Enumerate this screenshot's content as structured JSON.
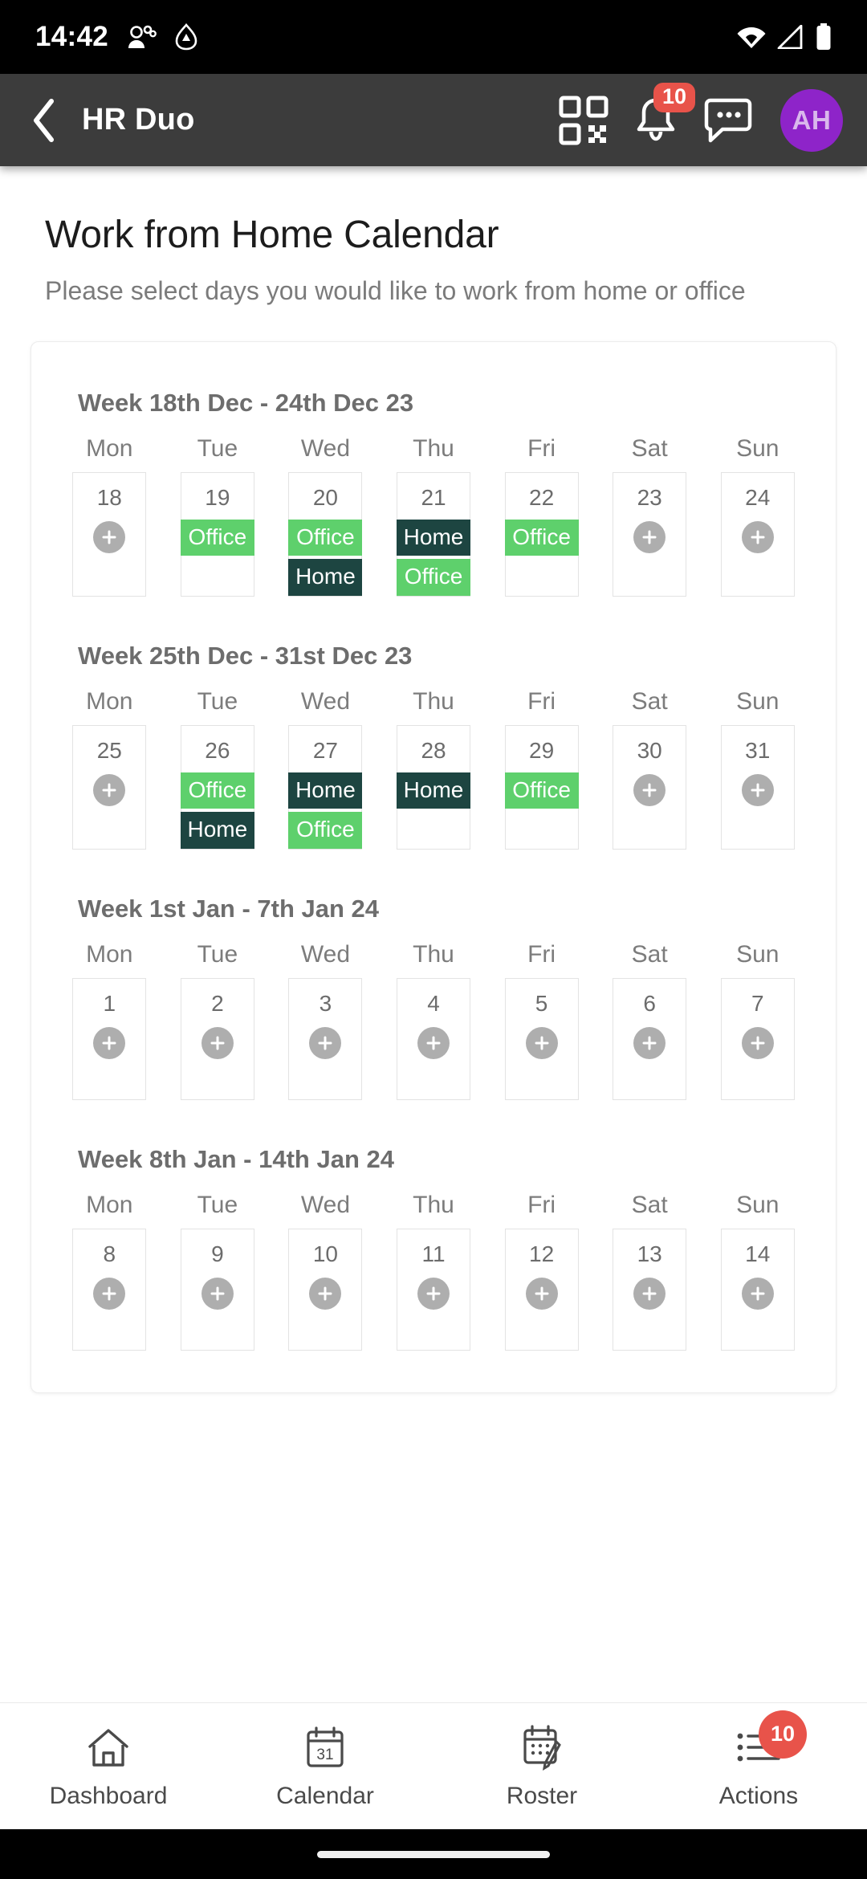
{
  "status_bar": {
    "time": "14:42",
    "icons": [
      "people-icon",
      "drive-triangle-icon",
      "wifi-icon",
      "signal-icon",
      "battery-icon"
    ]
  },
  "app_bar": {
    "back_icon": "chevron-left-icon",
    "title": "HR Duo",
    "qr_icon": "qr-code-icon",
    "bell_icon": "bell-icon",
    "bell_badge": "10",
    "chat_icon": "chat-bubble-icon",
    "avatar_initials": "AH",
    "avatar_color": "#8e24c9",
    "background": "#3c3c3c"
  },
  "page": {
    "title": "Work from Home Calendar",
    "subtitle": "Please select days you would like to work from home or office"
  },
  "legend_colors": {
    "office": "#5ed06c",
    "home": "#1d4541",
    "add_button": "#aeaeae",
    "badge_red": "#e8534a"
  },
  "calendar": {
    "day_headers": [
      "Mon",
      "Tue",
      "Wed",
      "Thu",
      "Fri",
      "Sat",
      "Sun"
    ],
    "add_icon": "plus-icon",
    "weeks": [
      {
        "title": "Week 18th Dec - 24th Dec 23",
        "days": [
          {
            "num": "18",
            "tags": [],
            "add": true
          },
          {
            "num": "19",
            "tags": [
              "Office"
            ],
            "add": false
          },
          {
            "num": "20",
            "tags": [
              "Office",
              "Home"
            ],
            "add": false
          },
          {
            "num": "21",
            "tags": [
              "Home",
              "Office"
            ],
            "add": false
          },
          {
            "num": "22",
            "tags": [
              "Office"
            ],
            "add": false
          },
          {
            "num": "23",
            "tags": [],
            "add": true
          },
          {
            "num": "24",
            "tags": [],
            "add": true
          }
        ]
      },
      {
        "title": "Week 25th Dec - 31st Dec 23",
        "days": [
          {
            "num": "25",
            "tags": [],
            "add": true
          },
          {
            "num": "26",
            "tags": [
              "Office",
              "Home"
            ],
            "add": false
          },
          {
            "num": "27",
            "tags": [
              "Home",
              "Office"
            ],
            "add": false
          },
          {
            "num": "28",
            "tags": [
              "Home"
            ],
            "add": false
          },
          {
            "num": "29",
            "tags": [
              "Office"
            ],
            "add": false
          },
          {
            "num": "30",
            "tags": [],
            "add": true
          },
          {
            "num": "31",
            "tags": [],
            "add": true
          }
        ]
      },
      {
        "title": "Week 1st Jan - 7th Jan 24",
        "days": [
          {
            "num": "1",
            "tags": [],
            "add": true
          },
          {
            "num": "2",
            "tags": [],
            "add": true
          },
          {
            "num": "3",
            "tags": [],
            "add": true
          },
          {
            "num": "4",
            "tags": [],
            "add": true
          },
          {
            "num": "5",
            "tags": [],
            "add": true
          },
          {
            "num": "6",
            "tags": [],
            "add": true
          },
          {
            "num": "7",
            "tags": [],
            "add": true
          }
        ]
      },
      {
        "title": "Week 8th Jan - 14th Jan 24",
        "days": [
          {
            "num": "8",
            "tags": [],
            "add": true
          },
          {
            "num": "9",
            "tags": [],
            "add": true
          },
          {
            "num": "10",
            "tags": [],
            "add": true
          },
          {
            "num": "11",
            "tags": [],
            "add": true
          },
          {
            "num": "12",
            "tags": [],
            "add": true
          },
          {
            "num": "13",
            "tags": [],
            "add": true
          },
          {
            "num": "14",
            "tags": [],
            "add": true
          }
        ]
      }
    ]
  },
  "bottom_nav": {
    "items": [
      {
        "label": "Dashboard",
        "icon": "home-icon",
        "badge": null
      },
      {
        "label": "Calendar",
        "icon": "calendar-31-icon",
        "badge": null
      },
      {
        "label": "Roster",
        "icon": "roster-pencil-icon",
        "badge": null
      },
      {
        "label": "Actions",
        "icon": "list-actions-icon",
        "badge": "10"
      }
    ]
  }
}
